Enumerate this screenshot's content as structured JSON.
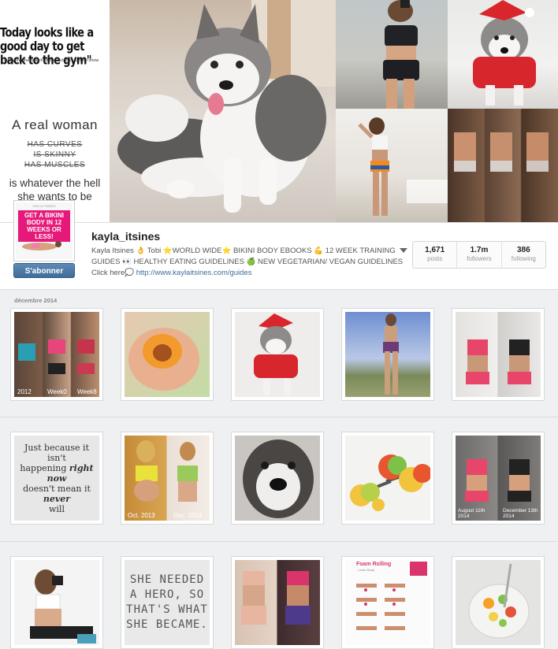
{
  "header": {
    "quote_top": "Today looks like a good day to get back to the gym\"",
    "quote_small": "- everyone that watched the Victoria's Secret show",
    "real_woman": "A real woman",
    "struck": [
      "HAS CURVES",
      "IS SKINNY",
      "HAS MUSCLES"
    ],
    "whatever": "is whatever the hell she wants to be"
  },
  "profile": {
    "avatar_brand": "KAYLA ITSINES",
    "avatar_text": "GET A BIKINI BODY IN 12 WEEKS OR LESS!",
    "subscribe_label": "S'abonner",
    "username": "kayla_itsines",
    "bio_line1": "Kayla Itsines 👌 Tobi ⭐WORLD WIDE⭐ BIKINI BODY EBOOKS 💪 12 WEEK TRAINING",
    "bio_line2": "GUIDES 👀 HEALTHY EATING GUIDELINES 🍏 NEW VEGETARIAN/ VEGAN GUIDELINES",
    "bio_line3_prefix": "Click here💭 ",
    "bio_link": "http://www.kaylaitsines.com/guides",
    "stats": [
      {
        "num": "1,671",
        "label": "posts"
      },
      {
        "num": "1.7m",
        "label": "followers"
      },
      {
        "num": "386",
        "label": "following"
      }
    ]
  },
  "feed": {
    "month": "décembre 2014",
    "row1_labels": [
      "2012",
      "Week0",
      "Week8"
    ],
    "quote1": "Just because it isn't happening right now doesn't mean it never will",
    "quote1_parts": [
      "Just because it isn't",
      "happening ",
      "right now",
      "doesn't mean it ",
      "never",
      "will"
    ],
    "row2_labels": [
      "Oct. 2013",
      "Dec. 2014"
    ],
    "row2_labels_b": [
      "August 11th 2014",
      "December 13th 2014"
    ],
    "quote2": "SHE NEEDED A HERO, SO THAT'S WHAT SHE BECAME.",
    "foam_title": "Foam Rolling",
    "foam_sub": "Lower Body"
  },
  "colors": {
    "accent": "#3f6d99",
    "avatar_pink": "#e6197a",
    "bg": "#eef0f1"
  }
}
